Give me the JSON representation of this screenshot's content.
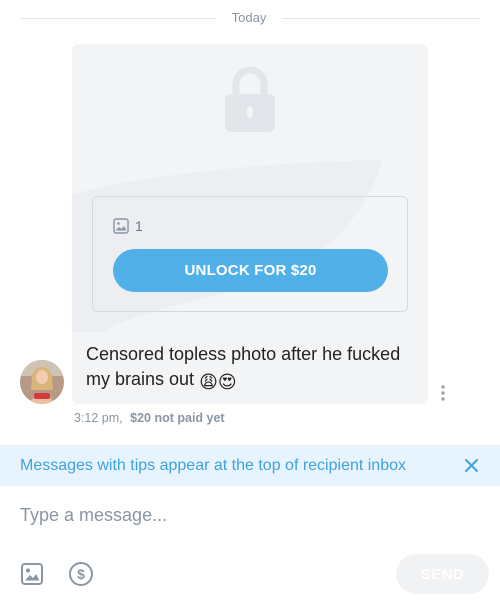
{
  "date_separator": "Today",
  "locked_post": {
    "media_count": "1",
    "unlock_label": "UNLOCK FOR $20",
    "media_icon": "image-icon",
    "lock_icon": "lock-icon"
  },
  "message": {
    "text": "Censored topless photo after he fucked my brains out",
    "emojis": [
      "😩",
      "😍"
    ],
    "time": "3:12 pm,",
    "paid_status": "$20 not paid yet"
  },
  "tips_banner": {
    "text": "Messages with tips appear at the top of recipient inbox",
    "close_icon": "close-icon"
  },
  "composer": {
    "placeholder": "Type a message...",
    "send_label": "SEND",
    "attach_icon": "image-icon",
    "tip_icon": "dollar-icon"
  },
  "colors": {
    "accent": "#52b0e8",
    "banner_bg": "#e7f4fd",
    "banner_text": "#3fa2de",
    "muted": "#8a96a3",
    "bubble_bg": "#f3f4f6"
  }
}
